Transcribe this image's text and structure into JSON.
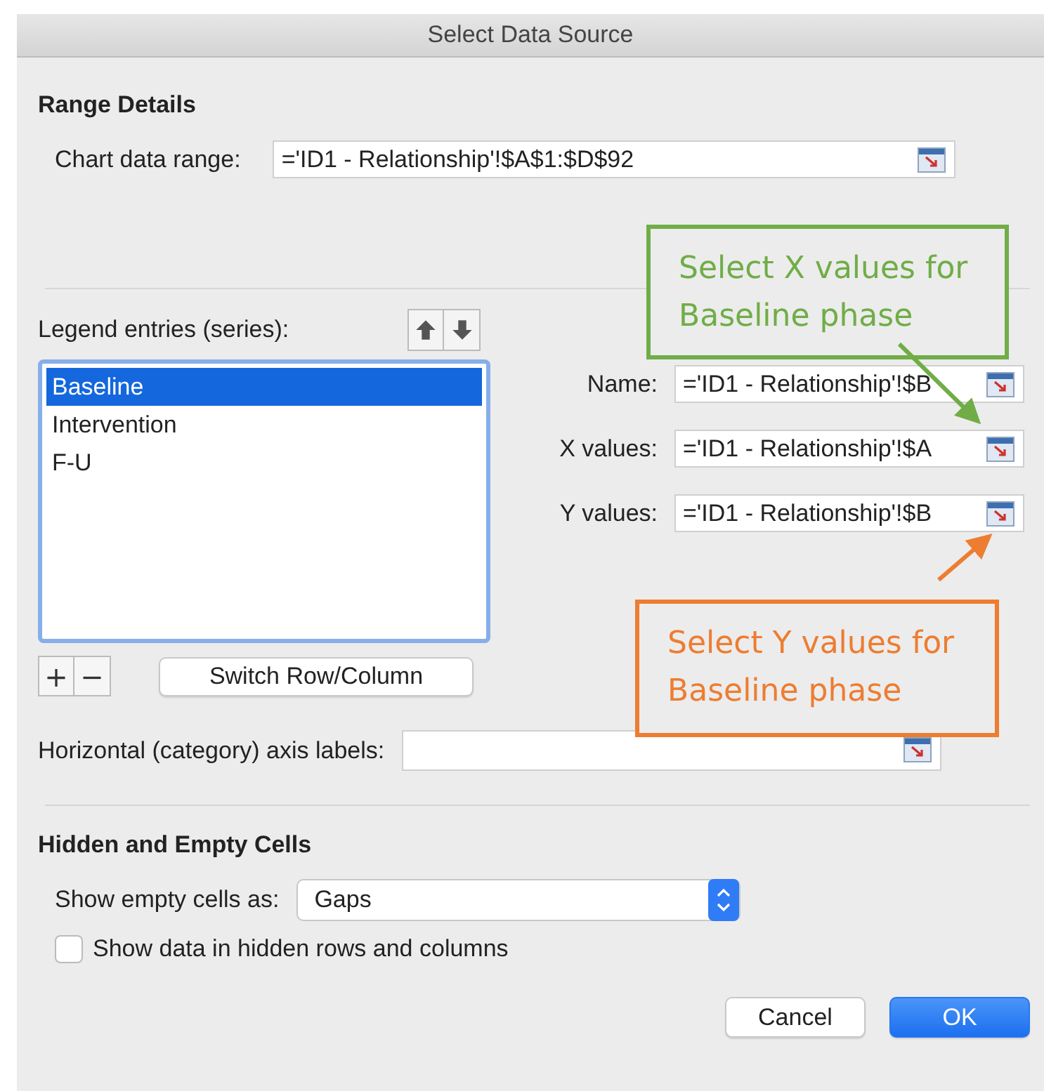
{
  "window": {
    "title": "Select Data Source"
  },
  "range_details": {
    "heading": "Range Details",
    "label": "Chart data range:",
    "value": "='ID1 - Relationship'!$A$1:$D$92"
  },
  "legend": {
    "label": "Legend entries (series):",
    "items": [
      {
        "label": "Baseline",
        "selected": true
      },
      {
        "label": "Intervention",
        "selected": false
      },
      {
        "label": "F-U",
        "selected": false
      }
    ]
  },
  "series_fields": [
    {
      "label": "Name:",
      "value": "='ID1 - Relationship'!$B"
    },
    {
      "label": "X values:",
      "value": "='ID1 - Relationship'!$A"
    },
    {
      "label": "Y values:",
      "value": "='ID1 - Relationship'!$B"
    }
  ],
  "list_buttons": [
    "+",
    "−"
  ],
  "switch_button": "Switch Row/Column",
  "axis_labels": {
    "label": "Horizontal (category) axis labels:"
  },
  "hidden_empty": {
    "heading": "Hidden and Empty Cells",
    "empty_cells_label": "Show empty cells as:",
    "empty_cells_value": "Gaps",
    "checkbox": {
      "label": "Show data in hidden rows and columns",
      "checked": false
    }
  },
  "buttons": [
    {
      "label": "Cancel",
      "kind": "default"
    },
    {
      "label": "OK",
      "kind": "primary"
    }
  ],
  "callouts": [
    {
      "lines": [
        "Select X values for",
        "Baseline phase"
      ],
      "color": "#70ad47"
    },
    {
      "lines": [
        "Select Y values for",
        "Baseline phase"
      ],
      "color": "#ed7d31"
    }
  ]
}
